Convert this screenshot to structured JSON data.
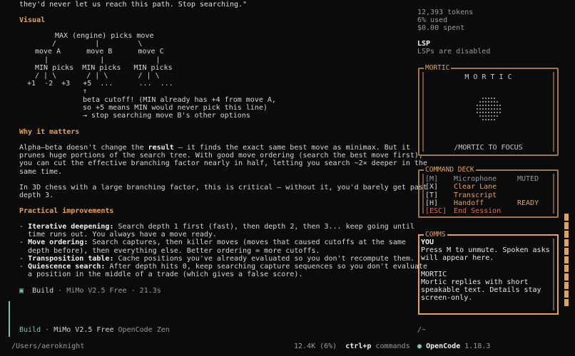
{
  "article": {
    "intro_tail": "they'd never let us reach this path. Stop searching.\"",
    "visual_heading": "Visual",
    "diagram": {
      "root": "MAX (engine) picks move",
      "edges1": "/         |         \\",
      "moves": "move A      move B      move C",
      "pipes": "|            |            |",
      "min_picks": "MIN picks  MIN picks   MIN picks",
      "branches": "/ | \\       / | \\       / | \\",
      "values": "+1  -2  +3   +5  ...      ...  ...",
      "arrow": "↑",
      "note1": "beta cutoff! (MIN already has +4 from move A,",
      "note2": "so +5 means MIN would never pick this line)",
      "note3": "→ stop searching move B's other options"
    },
    "why_heading": "Why it matters",
    "why_p1_a": "Alpha–beta doesn't change the ",
    "why_p1_bold": "result",
    "why_p1_b": " — it finds the exact same best move as minimax. But it",
    "why_p1_l2": "prunes huge portions of the search tree. With good move ordering (search the best move first),",
    "why_p1_l3": "you can cut the effective branching factor nearly in half, letting you search ~2× deeper in the",
    "why_p1_l4": "same time.",
    "why_p2_l1": "In 3D chess with a large branching factor, this is critical — without it, you'd barely get past",
    "why_p2_l2": "depth 3.",
    "practical_heading": "Practical improvements",
    "items": [
      {
        "term": "Iterative deepening:",
        "l1": " Search depth 1 first (fast), then depth 2, then 3... keep going until",
        "l2": "  time runs out. You always have a move ready."
      },
      {
        "term": "Move ordering:",
        "l1": " Search captures, then killer moves (moves that caused cutoffs at the same",
        "l2": "  depth before), then everything else. Better ordering = more cutoffs."
      },
      {
        "term": "Transposition table:",
        "l1": " Cache positions you've already evaluated so you don't recompute them.",
        "l2": ""
      },
      {
        "term": "Quiescence search:",
        "l1": " After depth hits 0, keep searching capture sequences so you don't evaluate",
        "l2": "  a position in the middle of a trade (which gives a false score)."
      }
    ],
    "bullet": "-",
    "build_status": {
      "mode": "Build",
      "model": "MiMo V2.5 Free",
      "duration": "21.3s",
      "sep": "·"
    }
  },
  "input": {
    "mode": "Build",
    "model": "MiMo V2.5 Free",
    "provider": "OpenCode Zen"
  },
  "footer": {
    "path": "/Users/aeroknight",
    "usage": "12.4K (6%)",
    "shortcut_key": "ctrl+p",
    "shortcut_label": "commands",
    "app_bold": "OpenCode",
    "version": "1.18.3",
    "dot": "●"
  },
  "sidebar": {
    "tokens": "12,393 tokens",
    "used": "6% used",
    "spent": "$0.00 spent",
    "lsp_title": "LSP",
    "lsp_status": "LSPs are disabled",
    "mortic": {
      "title": "MORTIC",
      "name": "M O R T I C",
      "hint": "/MORTIC TO FOCUS"
    },
    "deck": {
      "title": "COMMAND DECK",
      "rows": [
        {
          "key": "[M]",
          "label": "Microphone",
          "state": "MUTED"
        },
        {
          "key": "[X]",
          "label": "Clear Lane",
          "state": ""
        },
        {
          "key": "[T]",
          "label": "Transcript",
          "state": ""
        },
        {
          "key": "[H]",
          "label": "Handoff",
          "state": "READY"
        },
        {
          "key": "[ESC]",
          "label": "End Session",
          "state": ""
        }
      ]
    },
    "comms": {
      "title": "COMMS",
      "you_label": "YOU",
      "you_text_l1": "Press M to unmute. Spoken asks",
      "you_text_l2": "will appear here.",
      "mortic_label": "MORTIC",
      "mortic_text_l1": "Mortic replies with short",
      "mortic_text_l2": "speakable text. Details stay",
      "mortic_text_l3": "screen-only."
    },
    "cwd": "/~"
  },
  "colors": {
    "accent": "#e0a35c",
    "build_green": "#7fc7a8",
    "end_red": "#e06a5a",
    "frame": "#9c7657"
  }
}
